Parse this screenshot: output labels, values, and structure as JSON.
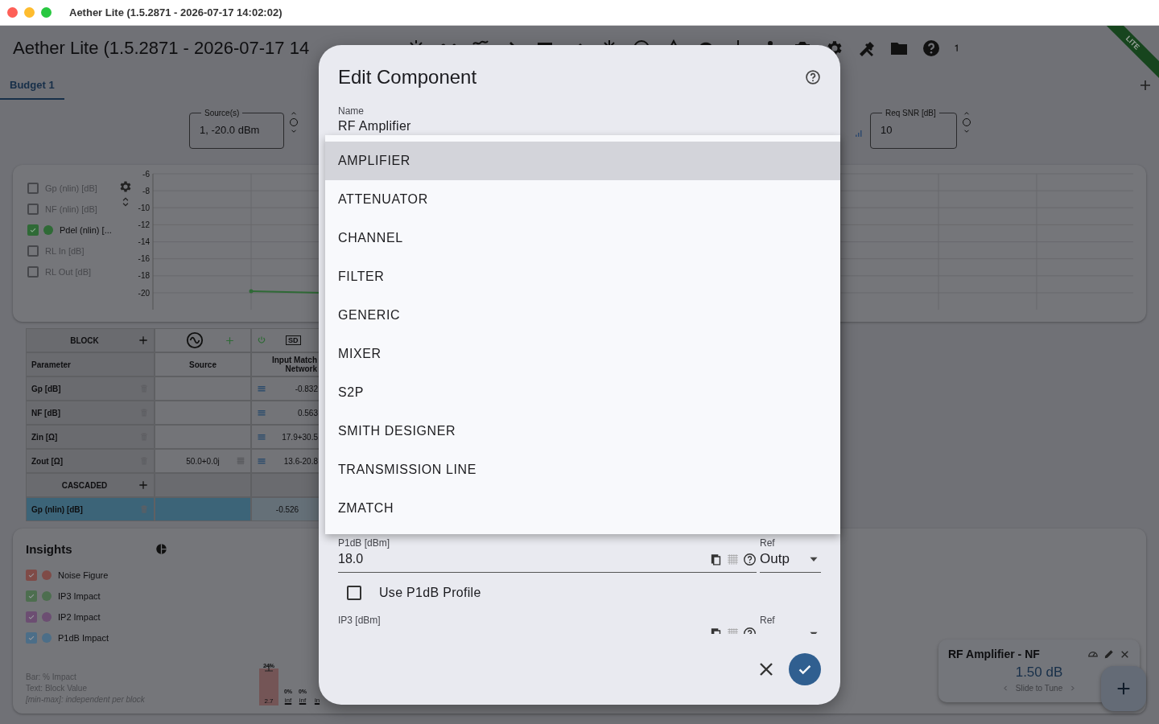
{
  "window": {
    "title": "Aether Lite (1.5.2871 - 2026-07-17 14:02:02)"
  },
  "app": {
    "title": "Aether Lite (1.5.2871 - 2026-07-17 14",
    "badge": "LITE"
  },
  "tabs": [
    {
      "label": "Budget 1",
      "selected": true
    }
  ],
  "source": {
    "label": "Source(s)",
    "value": "1, -20.0 dBm"
  },
  "req_snr": {
    "label": "Req SNR [dB]",
    "value": "10"
  },
  "traces": [
    {
      "label": "Gp (nlin) [dB]",
      "checked": false
    },
    {
      "label": "NF (nlin) [dB]",
      "checked": false
    },
    {
      "label": "Pdel (nlin) [...",
      "checked": true,
      "color": "#2f6a36"
    },
    {
      "label": "RL In [dB]",
      "checked": false
    },
    {
      "label": "RL Out [dB]",
      "checked": false
    }
  ],
  "chart": {
    "y_ticks": [
      "-6",
      "-8",
      "-10",
      "-12",
      "-14",
      "-16",
      "-18",
      "-20"
    ]
  },
  "table": {
    "block_label": "BLOCK",
    "cascaded_label": "CASCADED",
    "imn_badge": "SD",
    "columns": [
      "Parameter",
      "Source",
      "Input Match Network"
    ],
    "rows": [
      {
        "parameter": "Gp [dB]",
        "input_match": "-0.832",
        "selected": false
      },
      {
        "parameter": "NF [dB]",
        "input_match": "0.563",
        "selected": false
      },
      {
        "parameter": "Zin [Ω]",
        "input_match": "17.9+30.5",
        "selected": false
      },
      {
        "parameter": "Zout [Ω]",
        "source": "50.0+0.0j",
        "input_match": "13.6-20.8",
        "selected": false
      }
    ],
    "cascaded_rows": [
      {
        "parameter": "Gp (nlin) [dB]",
        "input_match": "-0.526",
        "selected": true
      }
    ]
  },
  "insights": {
    "title": "Insights",
    "items": [
      {
        "label": "Noise Figure",
        "checked": true,
        "color": "#7f4b47"
      },
      {
        "label": "IP3 Impact",
        "checked": true,
        "color": "#4d6e4f"
      },
      {
        "label": "IP2 Impact",
        "checked": true,
        "color": "#6c4e72"
      },
      {
        "label": "P1dB Impact",
        "checked": true,
        "color": "#4c6e88"
      }
    ],
    "notes": [
      {
        "text": "Bar: % Impact",
        "italic": false
      },
      {
        "text": "Text: Block Value",
        "italic": false
      },
      {
        "text": "[min-max]: independent per block",
        "italic": true
      }
    ],
    "bars": [
      {
        "percent": "24%",
        "value": "2.7",
        "level": 0.24
      },
      {
        "percent": "0%",
        "value": "inf"
      },
      {
        "percent": "0%",
        "value": "inf"
      },
      {
        "value": "in"
      }
    ]
  },
  "tuner": {
    "title": "RF Amplifier - NF",
    "value": "1.50 dB",
    "hint": "Slide to Tune"
  },
  "dialog": {
    "title": "Edit Component",
    "name_label": "Name",
    "name_value": "RF Amplifier",
    "type_menu": [
      {
        "label": "AMPLIFIER",
        "selected": true
      },
      {
        "label": "ATTENUATOR",
        "selected": false
      },
      {
        "label": "CHANNEL",
        "selected": false
      },
      {
        "label": "FILTER",
        "selected": false
      },
      {
        "label": "GENERIC",
        "selected": false
      },
      {
        "label": "MIXER",
        "selected": false
      },
      {
        "label": "S2P",
        "selected": false
      },
      {
        "label": "SMITH DESIGNER",
        "selected": false
      },
      {
        "label": "TRANSMISSION LINE",
        "selected": false
      },
      {
        "label": "ZMATCH",
        "selected": false
      }
    ],
    "p1db": {
      "label": "P1dB [dBm]",
      "value": "18.0",
      "ref_label": "Ref",
      "ref_value": "Outp"
    },
    "use_profile": {
      "label": "Use P1dB Profile",
      "checked": false
    },
    "ip3": {
      "label": "IP3 [dBm]",
      "ref_label": "Ref"
    }
  }
}
